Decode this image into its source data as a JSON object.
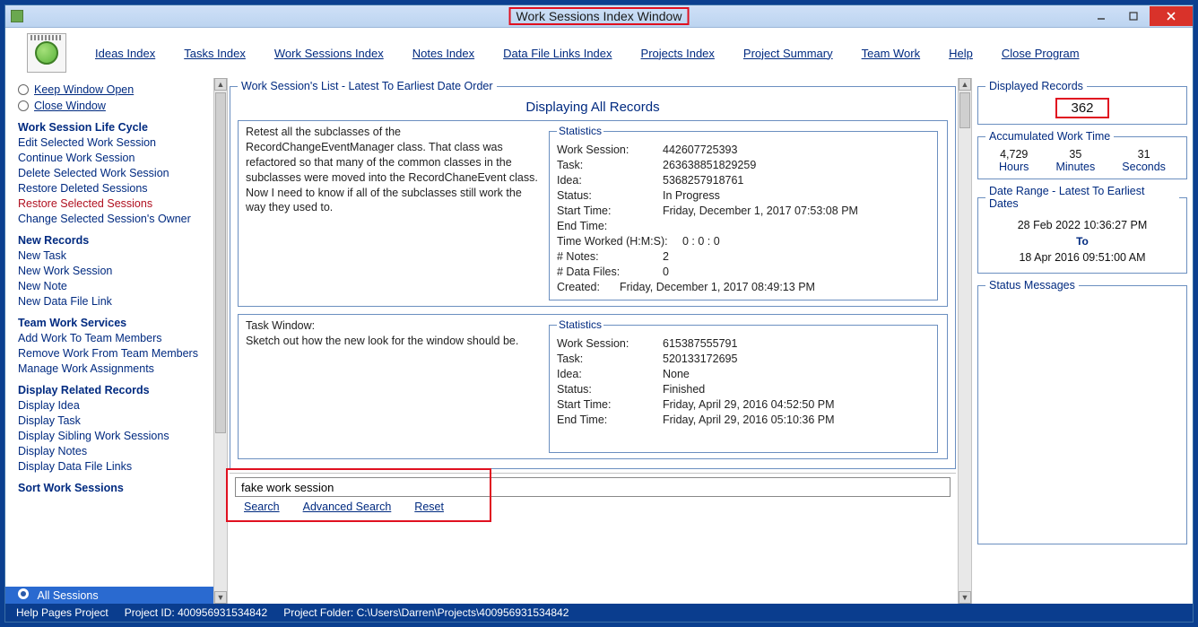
{
  "window": {
    "title": "Work Sessions Index Window"
  },
  "topnav": {
    "ideas": "Ideas Index",
    "tasks": "Tasks Index",
    "work_sessions": "Work Sessions Index",
    "notes": "Notes Index",
    "data_files": "Data File Links Index",
    "projects": "Projects Index",
    "project_summary": "Project Summary",
    "team_work": "Team Work",
    "help": "Help",
    "close": "Close Program"
  },
  "sidebar": {
    "keep_open": "Keep Window Open",
    "close_window": "Close Window",
    "life_cycle_head": "Work Session Life Cycle",
    "life_cycle": [
      "Edit Selected Work Session",
      "Continue Work Session",
      "Delete Selected Work Session",
      "Restore Deleted Sessions",
      "Restore Selected Sessions",
      "Change Selected Session's Owner"
    ],
    "new_records_head": "New Records",
    "new_records": [
      "New Task",
      "New Work Session",
      "New Note",
      "New Data File Link"
    ],
    "team_head": "Team Work Services",
    "team": [
      "Add Work To Team Members",
      "Remove Work From Team Members",
      "Manage Work Assignments"
    ],
    "display_head": "Display Related Records",
    "display": [
      "Display Idea",
      "Display Task",
      "Display Sibling Work Sessions",
      "Display Notes",
      "Display Data File Links"
    ],
    "sort_head": "Sort Work Sessions",
    "all_sessions": "All Sessions"
  },
  "center": {
    "group_legend": "Work Session's List - Latest To Earliest Date Order",
    "display_all": "Displaying All Records",
    "records": [
      {
        "desc_title": "Retest all the subclasses of the RecordChangeEventManager class. That class was refactored so that many of the common classes in the subclasses were moved into the RecordChaneEvent class. Now I need to know if all of the subclasses still work the way they used to.",
        "work_session": "442607725393",
        "task": "263638851829259",
        "idea": "5368257918761",
        "status": "In Progress",
        "start_time": "Friday, December 1, 2017   07:53:08 PM",
        "end_time": "",
        "time_worked": "0  :  0   :  0",
        "num_notes": "2",
        "num_data_files": "0",
        "created": "Friday, December 1, 2017   08:49:13 PM"
      },
      {
        "desc_title": "Task Window:\nSketch out how the new look for the window should be.",
        "work_session": "615387555791",
        "task": "520133172695",
        "idea": "None",
        "status": "Finished",
        "start_time": "Friday, April 29, 2016   04:52:50 PM",
        "end_time": "Friday, April 29, 2016   05:10:36 PM"
      }
    ],
    "stats_labels": {
      "legend": "Statistics",
      "work_session": "Work Session:",
      "task": "Task:",
      "idea": "Idea:",
      "status": "Status:",
      "start_time": "Start Time:",
      "end_time": "End Time:",
      "time_worked": "Time Worked (H:M:S):",
      "num_notes": "# Notes:",
      "num_data_files": "# Data Files:",
      "created": "Created:"
    }
  },
  "search": {
    "value": "fake work session",
    "search_label": "Search",
    "advanced_label": "Advanced Search",
    "reset_label": "Reset"
  },
  "right": {
    "displayed_legend": "Displayed Records",
    "displayed_count": "362",
    "accum_legend": "Accumulated Work Time",
    "hours_val": "4,729",
    "hours_lbl": "Hours",
    "minutes_val": "35",
    "minutes_lbl": "Minutes",
    "seconds_val": "31",
    "seconds_lbl": "Seconds",
    "daterange_legend": "Date Range - Latest To Earliest Dates",
    "date_latest": "28 Feb 2022  10:36:27 PM",
    "date_to": "To",
    "date_earliest": "18 Apr 2016  09:51:00 AM",
    "status_legend": "Status Messages"
  },
  "status": {
    "help_pages": "Help Pages Project",
    "project_id_lbl": "Project ID:",
    "project_id": "400956931534842",
    "project_folder_lbl": "Project Folder:",
    "project_folder": "C:\\Users\\Darren\\Projects\\400956931534842"
  }
}
